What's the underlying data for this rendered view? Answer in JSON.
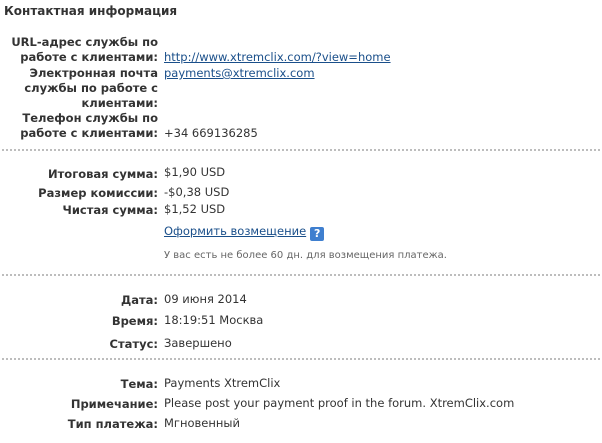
{
  "contact": {
    "section_title": "Контактная информация",
    "service_url_label_1": "URL-адрес службы по",
    "service_url_label_2": "работе с клиентами:",
    "service_url_value": "http://www.xtremclix.com/?view=home",
    "email_label_1": "Электронная почта",
    "email_label_2": "службы по работе с",
    "email_label_3": "клиентами:",
    "email_value": "payments@xtremclix.com",
    "phone_label_1": "Телефон службы по",
    "phone_label_2": "работе с клиентами:",
    "phone_value": "+34 669136285"
  },
  "amounts": {
    "total_label": "Итоговая сумма:",
    "total_value": "$1,90 USD",
    "fee_label": "Размер комиссии:",
    "fee_value": "-$0,38 USD",
    "net_label": "Чистая сумма:",
    "net_value": "$1,52 USD",
    "refund_link": "Оформить возмещение",
    "help_icon_text": "?",
    "refund_note": "У вас есть не более 60 дн. для возмещения платежа."
  },
  "details": {
    "date_label": "Дата:",
    "date_value": "09 июня 2014",
    "time_label": "Время:",
    "time_value": "18:19:51 Москва",
    "status_label": "Статус:",
    "status_value": "Завершено"
  },
  "payment": {
    "subject_label": "Тема:",
    "subject_value": "Payments XtremClix",
    "note_label": "Примечание:",
    "note_value": "Please post your payment proof in the forum. XtremClix.com",
    "type_label": "Тип платежа:",
    "type_value": "Мгновенный"
  },
  "colors": {
    "link": "#1a4f8a",
    "help_icon_bg": "#3f7fcf",
    "separator": "#bdbdbd"
  }
}
